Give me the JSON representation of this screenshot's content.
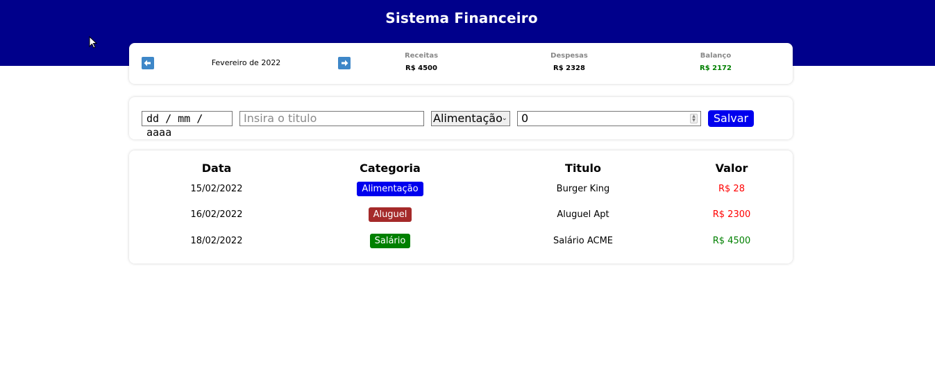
{
  "header": {
    "title": "Sistema Financeiro"
  },
  "info": {
    "month_label": "Fevereiro de 2022",
    "prev_icon": "arrow-left-icon",
    "next_icon": "arrow-right-icon",
    "receitas_label": "Receitas",
    "receitas_value": "R$ 4500",
    "despesas_label": "Despesas",
    "despesas_value": "R$ 2328",
    "balanco_label": "Balanço",
    "balanco_value": "R$ 2172",
    "balanco_color": "#008000"
  },
  "form": {
    "date_placeholder": "dd / mm / aaaa",
    "title_placeholder": "Insira o titulo",
    "category_selected": "Alimentação",
    "amount_value": "0",
    "save_label": "Salvar"
  },
  "table": {
    "headers": [
      "Data",
      "Categoria",
      "Titulo",
      "Valor"
    ],
    "rows": [
      {
        "date": "15/02/2022",
        "category": "Alimentação",
        "category_color": "#0000ee",
        "title": "Burger King",
        "value": "R$ 28",
        "value_color": "#ff0000"
      },
      {
        "date": "16/02/2022",
        "category": "Aluguel",
        "category_color": "#a52a2a",
        "title": "Aluguel Apt",
        "value": "R$ 2300",
        "value_color": "#ff0000"
      },
      {
        "date": "18/02/2022",
        "category": "Salário",
        "category_color": "#008000",
        "title": "Salário ACME",
        "value": "R$ 4500",
        "value_color": "#008000"
      }
    ]
  },
  "colors": {
    "header_bg": "#00008b",
    "accent_button": "#0000ee",
    "nav_arrow": "#3e87c8"
  }
}
